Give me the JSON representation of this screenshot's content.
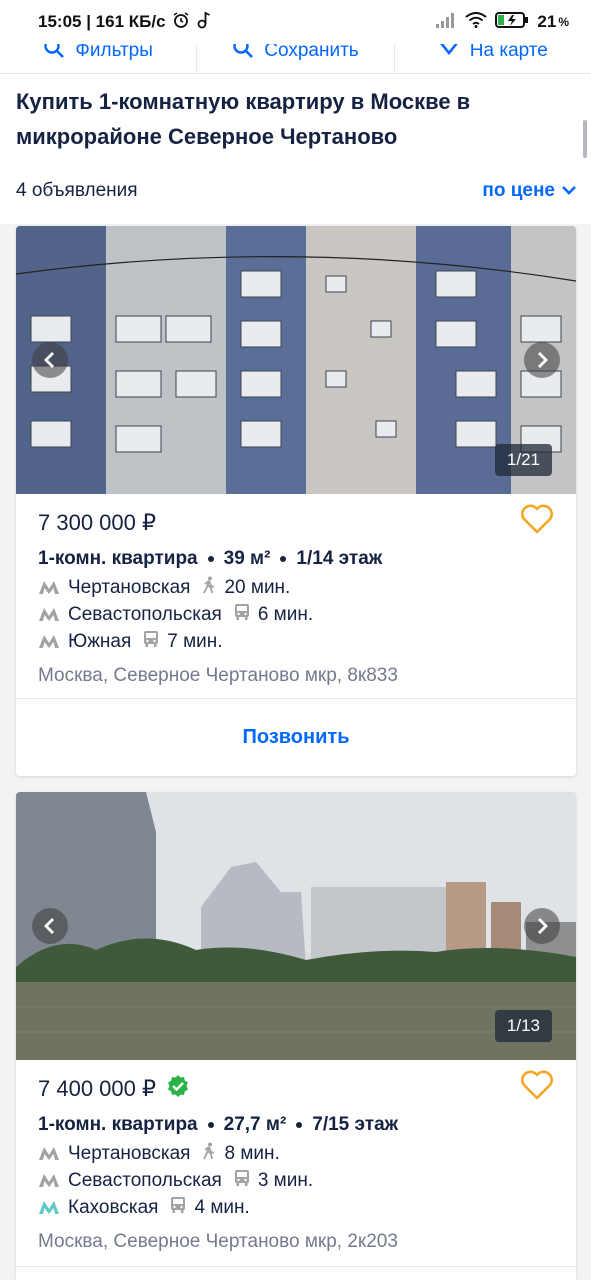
{
  "status_bar": {
    "time_speed": "15:05 | 161 КБ/с",
    "battery": "21",
    "battery_unit": "%"
  },
  "toolbar": {
    "filters_label": "Фильтры",
    "save_label": "Сохранить",
    "map_label": "На карте"
  },
  "page": {
    "title": "Купить 1-комнатную квартиру в Москве в микрорайоне Северное Чертаново",
    "count": "4 объявления",
    "sort_label": "по цене"
  },
  "listings": [
    {
      "price": "7 300 000 ₽",
      "verified": false,
      "type": "1-комн. квартира",
      "area": "39 м²",
      "floor": "1/14 этаж",
      "photo_counter": "1/21",
      "metro": [
        {
          "station": "Чертановская",
          "transport": "walk",
          "time": "20 мин.",
          "color": "#a1a2a3"
        },
        {
          "station": "Севастопольская",
          "transport": "bus",
          "time": "6 мин.",
          "color": "#a1a2a3"
        },
        {
          "station": "Южная",
          "transport": "bus",
          "time": "7 мин.",
          "color": "#a1a2a3"
        }
      ],
      "address": "Москва, Северное Чертаново мкр, 8к833",
      "call_label": "Позвонить"
    },
    {
      "price": "7 400 000 ₽",
      "verified": true,
      "type": "1-комн. квартира",
      "area": "27,7 м²",
      "floor": "7/15 этаж",
      "photo_counter": "1/13",
      "metro": [
        {
          "station": "Чертановская",
          "transport": "walk",
          "time": "8 мин.",
          "color": "#a1a2a3"
        },
        {
          "station": "Севастопольская",
          "transport": "bus",
          "time": "3 мин.",
          "color": "#a1a2a3"
        },
        {
          "station": "Каховская",
          "transport": "bus",
          "time": "4 мин.",
          "color": "#5ec9c5"
        }
      ],
      "address": "Москва, Северное Чертаново мкр, 2к203"
    }
  ],
  "colors": {
    "accent": "#0468ff",
    "favorite": "#f5a623",
    "verified": "#2bb34a",
    "text": "#152242",
    "muted": "#737a8e"
  }
}
